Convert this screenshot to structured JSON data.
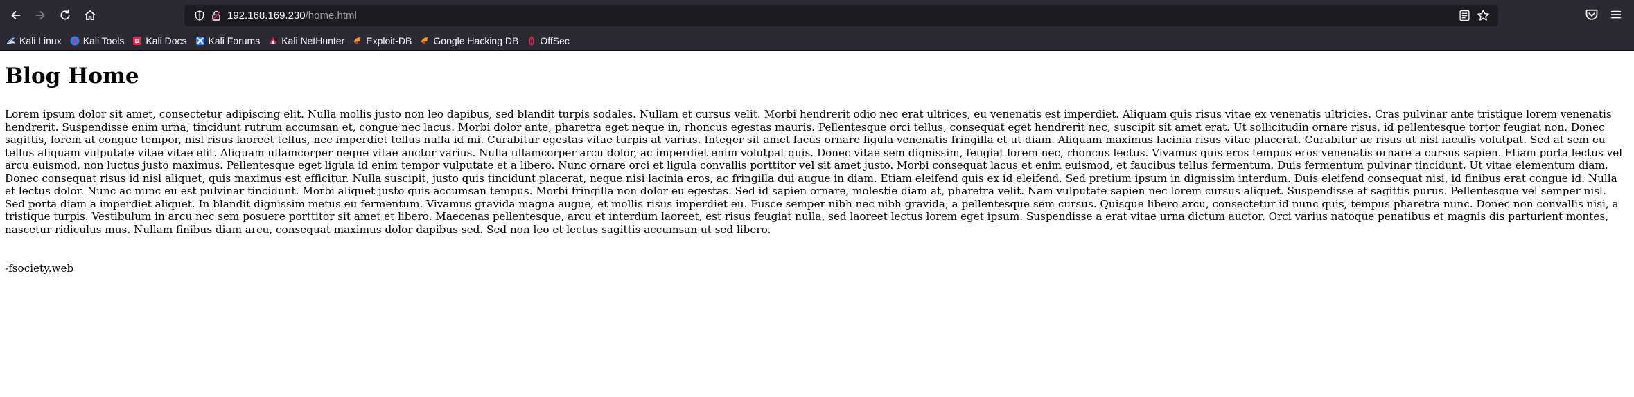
{
  "browser": {
    "url_host": "192.168.169.230",
    "url_path": "/home.html",
    "bookmarks": [
      {
        "label": "Kali Linux",
        "icon": "kali-dragon-icon"
      },
      {
        "label": "Kali Tools",
        "icon": "kali-tools-icon"
      },
      {
        "label": "Kali Docs",
        "icon": "kali-docs-icon"
      },
      {
        "label": "Kali Forums",
        "icon": "kali-forums-icon"
      },
      {
        "label": "Kali NetHunter",
        "icon": "nethunter-icon"
      },
      {
        "label": "Exploit-DB",
        "icon": "exploit-db-icon"
      },
      {
        "label": "Google Hacking DB",
        "icon": "ghdb-icon"
      },
      {
        "label": "OffSec",
        "icon": "offsec-icon"
      }
    ],
    "colors": {
      "chrome_bg": "#2b2a33",
      "urlbar_bg": "#1c1b22",
      "text": "#fbfbfe",
      "muted": "#9f9ea6"
    }
  },
  "page": {
    "title": "Blog Home",
    "body": "Lorem ipsum dolor sit amet, consectetur adipiscing elit. Nulla mollis justo non leo dapibus, sed blandit turpis sodales. Nullam et cursus velit. Morbi hendrerit odio nec erat ultrices, eu venenatis est imperdiet. Aliquam quis risus vitae ex venenatis ultricies. Cras pulvinar ante tristique lorem venenatis hendrerit. Suspendisse enim urna, tincidunt rutrum accumsan et, congue nec lacus. Morbi dolor ante, pharetra eget neque in, rhoncus egestas mauris. Pellentesque orci tellus, consequat eget hendrerit nec, suscipit sit amet erat. Ut sollicitudin ornare risus, id pellentesque tortor feugiat non. Donec sagittis, lorem at congue tempor, nisl risus laoreet tellus, nec imperdiet tellus nulla id mi. Curabitur egestas vitae turpis at varius. Integer sit amet lacus ornare ligula venenatis fringilla et ut diam. Aliquam maximus lacinia risus vitae placerat. Curabitur ac risus ut nisl iaculis volutpat. Sed at sem eu tellus aliquam vulputate vitae vitae elit. Aliquam ullamcorper neque vitae auctor varius. Nulla ullamcorper arcu dolor, ac imperdiet enim volutpat quis. Donec vitae sem dignissim, feugiat lorem nec, rhoncus lectus. Vivamus quis eros tempus eros venenatis ornare a cursus sapien. Etiam porta lectus vel arcu euismod, non luctus justo maximus. Pellentesque eget ligula id enim tempor vulputate et a libero. Nunc ornare orci et ligula convallis porttitor vel sit amet justo. Morbi consequat lacus et enim euismod, et faucibus tellus fermentum. Duis fermentum pulvinar tincidunt. Ut vitae elementum diam. Donec consequat risus id nisl aliquet, quis maximus est efficitur. Nulla suscipit, justo quis tincidunt placerat, neque nisi lacinia eros, ac fringilla dui augue in diam. Etiam eleifend quis ex id eleifend. Sed pretium ipsum in dignissim interdum. Duis eleifend consequat nisi, id finibus erat congue id. Nulla et lectus dolor. Nunc ac nunc eu est pulvinar tincidunt. Morbi aliquet justo quis accumsan tempus. Morbi fringilla non dolor eu egestas. Sed id sapien ornare, molestie diam at, pharetra velit. Nam vulputate sapien nec lorem cursus aliquet. Suspendisse at sagittis purus. Pellentesque vel semper nisl. Sed porta diam a imperdiet aliquet. In blandit dignissim metus eu fermentum. Vivamus gravida magna augue, et mollis risus imperdiet eu. Fusce semper nibh nec nibh gravida, a pellentesque sem cursus. Quisque libero arcu, consectetur id nunc quis, tempus pharetra nunc. Donec non convallis nisi, a tristique turpis. Vestibulum in arcu nec sem posuere porttitor sit amet et libero. Maecenas pellentesque, arcu et interdum laoreet, est risus feugiat nulla, sed laoreet lectus lorem eget ipsum. Suspendisse a erat vitae urna dictum auctor. Orci varius natoque penatibus et magnis dis parturient montes, nascetur ridiculus mus. Nullam finibus diam arcu, consequat maximus dolor dapibus sed. Sed non leo et lectus sagittis accumsan ut sed libero.",
    "signature": "-fsociety.web"
  }
}
